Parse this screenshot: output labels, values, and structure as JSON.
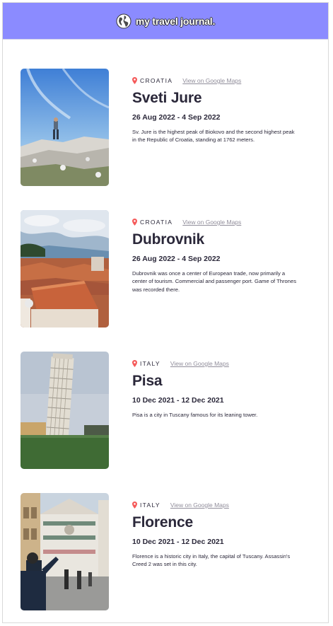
{
  "header": {
    "brand": "my travel journal.",
    "icon": "globe-icon"
  },
  "entries": [
    {
      "country": "CROATIA",
      "maps_link": "View on Google Maps",
      "title": "Sveti Jure",
      "dates": "26 Aug 2022 - 4 Sep 2022",
      "description": "Sv. Jure is the highest peak of Biokovo and the second highest peak in the Republic of Croatia, standing at 1762 meters."
    },
    {
      "country": "CROATIA",
      "maps_link": "View on Google Maps",
      "title": "Dubrovnik",
      "dates": "26 Aug 2022 - 4 Sep 2022",
      "description": "Dubrovnik was once a center of European trade, now primarily a center of tourism. Commercial and passenger port. Game of Thrones was recorded there."
    },
    {
      "country": "ITALY",
      "maps_link": "View on Google Maps",
      "title": "Pisa",
      "dates": "10 Dec 2021 - 12 Dec 2021",
      "description": "Pisa is a city in Tuscany famous for its leaning tower."
    },
    {
      "country": "ITALY",
      "maps_link": "View on Google Maps",
      "title": "Florence",
      "dates": "10 Dec 2021 - 12 Dec 2021",
      "description": "Florence is a historic city in Italy, the capital of Tuscany. Assassin's Creed 2 was set in this city."
    }
  ],
  "colors": {
    "header_bg": "#8b8bff",
    "pin": "#f55a5a",
    "text": "#2b283a",
    "link": "#918e9b"
  }
}
